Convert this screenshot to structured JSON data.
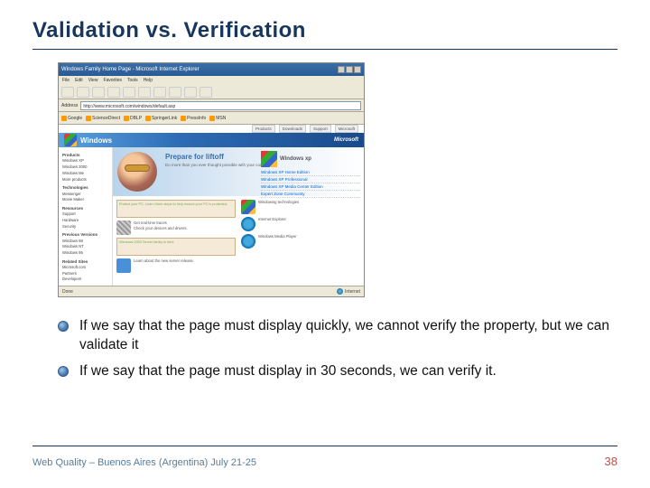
{
  "title": "Validation vs. Verification",
  "browser": {
    "window_title": "Windows Family Home Page - Microsoft Internet Explorer",
    "menu": [
      "File",
      "Edit",
      "View",
      "Favorites",
      "Tools",
      "Help"
    ],
    "address_label": "Address",
    "address_value": "http://www.microsoft.com/windows/default.asp",
    "links_bar": [
      "Google",
      "ScienceDirect",
      "DBLP",
      "SpringerLink",
      "PressInfo",
      "MSN"
    ],
    "topnav": [
      "Products",
      "Downloads",
      "Support",
      "Microsoft"
    ],
    "banner_title": "Windows",
    "ms_logo": "Microsoft",
    "hero": {
      "title": "Prepare for liftoff",
      "subtitle": "Do more than you ever thought possible with your computer.",
      "xp_label": "Windows xp",
      "links": [
        "Windows XP Home Edition",
        "Windows XP Professional",
        "Windows XP Media Center Edition",
        "Expert Zone Community"
      ]
    },
    "sidebar": {
      "h1": "Products",
      "p1": [
        "Windows XP",
        "Windows 2000",
        "Windows Me",
        "More products"
      ],
      "h2": "Technologies",
      "p2": [
        "Messenger",
        "Movie Maker"
      ],
      "h3": "Resources",
      "p3": [
        "Support",
        "Hardware",
        "Security"
      ],
      "h4": "Previous Versions",
      "p4": [
        "Windows 98",
        "Windows NT",
        "Windows 95"
      ],
      "h5": "Related Sites",
      "p5": [
        "Microsoft.com",
        "Partners",
        "Developers"
      ]
    },
    "lower": {
      "card1": "Protect your PC. Learn three steps to help ensure your PC is protected.",
      "row1_title": "Get real-time traces",
      "row1_body": "Check your devices and drivers.",
      "card2": "Windows 2003 Server family is here",
      "row2_body": "Learn about the new server release."
    },
    "right_rows": [
      "Windowing technologies",
      "Internet Explorer",
      "Windows Media Player"
    ],
    "status_left": "Done",
    "status_right": "Internet"
  },
  "bullets": [
    "If we say that the page must display quickly, we cannot verify the property, but we can validate it",
    "If we say that the page must display in 30 seconds, we can verify it."
  ],
  "footer_left": "Web Quality – Buenos Aires (Argentina) July 21-25",
  "page_number": "38"
}
